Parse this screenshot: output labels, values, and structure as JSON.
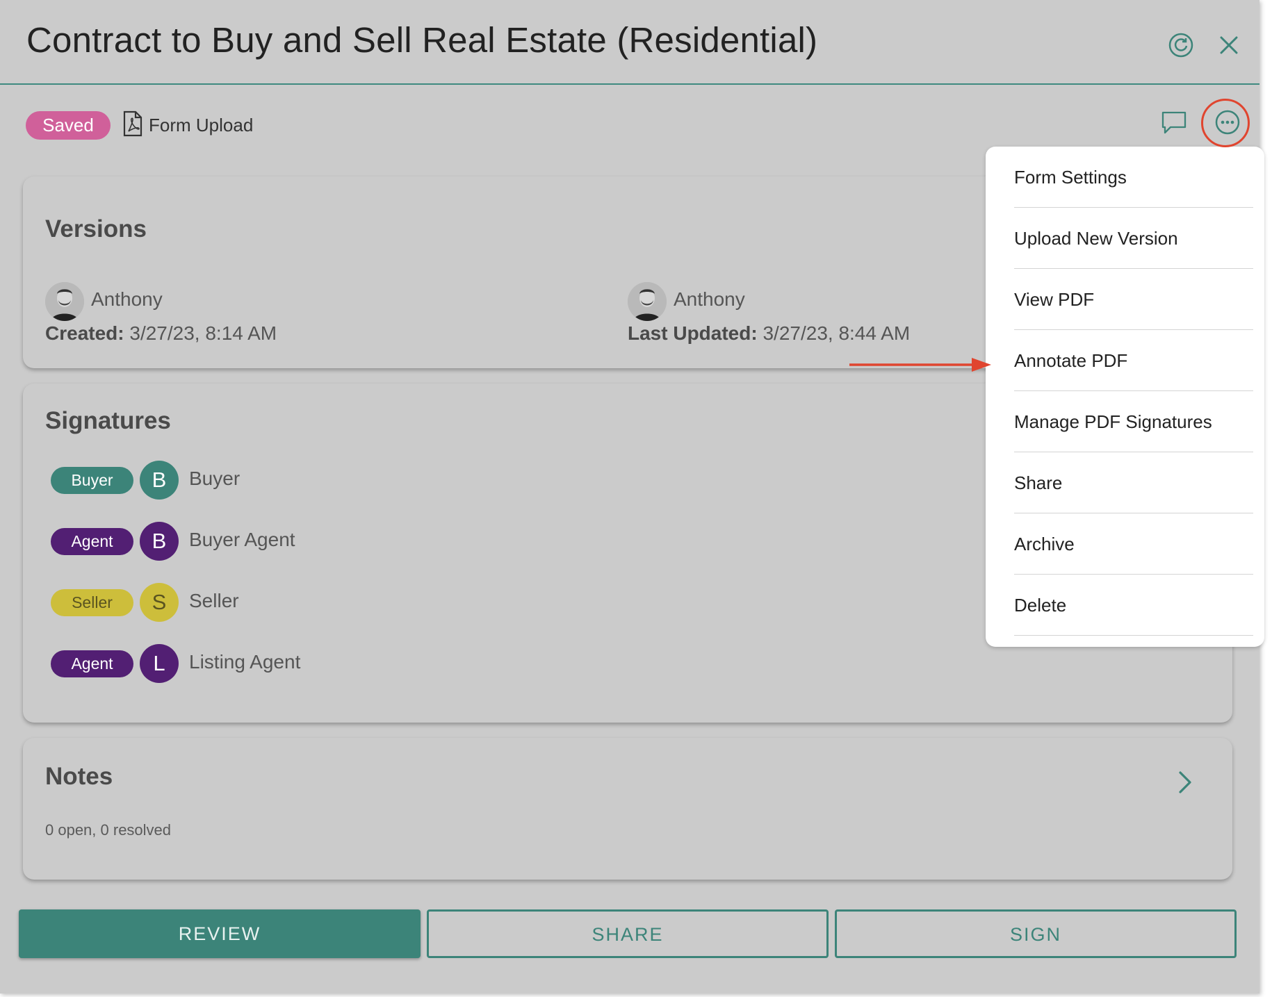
{
  "window": {
    "title": "Contract to Buy and Sell Real Estate (Residential)",
    "refresh_icon": "refresh-icon",
    "close_icon": "close-icon"
  },
  "toolbar": {
    "status_badge": "Saved",
    "status_color": "#d0609a",
    "form_type": "Form Upload",
    "form_icon": "pdf-file-icon",
    "comment_icon": "comment-icon",
    "more_icon": "more-options-icon"
  },
  "versions": {
    "title": "Versions",
    "created": {
      "name": "Anthony",
      "label": "Created:",
      "value": "3/27/23, 8:14 AM"
    },
    "updated": {
      "name": "Anthony",
      "label": "Last Updated:",
      "value": "3/27/23, 8:44 AM"
    }
  },
  "signatures": {
    "title": "Signatures",
    "rows": [
      {
        "role": "Buyer",
        "initial": "B",
        "name": "Buyer",
        "color": "#3c8479"
      },
      {
        "role": "Agent",
        "initial": "B",
        "name": "Buyer Agent",
        "color": "#521f73"
      },
      {
        "role": "Seller",
        "initial": "S",
        "name": "Seller",
        "color": "#cdbe3b"
      },
      {
        "role": "Agent",
        "initial": "L",
        "name": "Listing Agent",
        "color": "#521f73"
      }
    ]
  },
  "notes": {
    "title": "Notes",
    "summary": "0 open, 0 resolved"
  },
  "actions": {
    "review": "REVIEW",
    "share": "SHARE",
    "sign": "SIGN",
    "accent": "#3c8479"
  },
  "menu": {
    "items": [
      "Form Settings",
      "Upload New Version",
      "View PDF",
      "Annotate PDF",
      "Manage PDF Signatures",
      "Share",
      "Archive",
      "Delete"
    ]
  },
  "annotation": {
    "color": "#e0452f"
  }
}
